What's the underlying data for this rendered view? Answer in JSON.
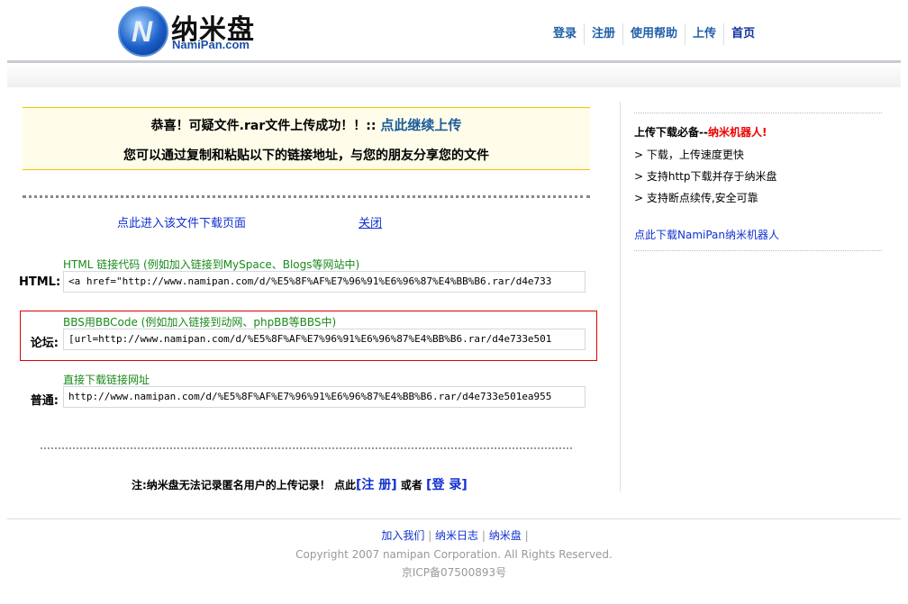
{
  "header": {
    "logo_cn": "纳米盘",
    "logo_en": "NamiPan.com",
    "nav": [
      "登录",
      "注册",
      "使用帮助",
      "上传",
      "首页"
    ]
  },
  "notice": {
    "line1": "恭喜！可疑文件.rar文件上传成功！！::",
    "continue_link": "点此继续上传",
    "line2": "您可以通过复制和粘贴以下的链接地址，与您的朋友分享您的文件"
  },
  "links": {
    "download_page": "点此进入该文件下载页面",
    "close": "关闭"
  },
  "codes": [
    {
      "caption": "HTML 链接代码 (例如加入链接到MySpace、Blogs等网站中)",
      "label": "HTML:",
      "value": "<a href=\"http://www.namipan.com/d/%E5%8F%AF%E7%96%91%E6%96%87%E4%BB%B6.rar/d4e733"
    },
    {
      "caption": "BBS用BBCode (例如加入链接到动网、phpBB等BBS中)",
      "label": "论坛:",
      "value": "[url=http://www.namipan.com/d/%E5%8F%AF%E7%96%91%E6%96%87%E4%BB%B6.rar/d4e733e501"
    },
    {
      "caption": "直接下载链接网址",
      "label": "普通:",
      "value": "http://www.namipan.com/d/%E5%8F%AF%E7%96%91%E6%96%87%E4%BB%B6.rar/d4e733e501ea955"
    }
  ],
  "note": {
    "text": "注:纳米盘无法记录匿名用户的上传记录！ 点此",
    "register": "[注 册]",
    "or": "或者",
    "login": "[登 录]"
  },
  "sidebar": {
    "title": "上传下载必备--",
    "title_red": "纳米机器人!",
    "items": [
      "> 下载，上传速度更快",
      "> 支持http下载并存于纳米盘",
      "> 支持断点续传,安全可靠"
    ],
    "link": "点此下载NamiPan纳米机器人"
  },
  "footer": {
    "links": [
      "加入我们",
      "纳米日志",
      "纳米盘"
    ],
    "copyright": "Copyright 2007 namipan Corporation. All Rights Reserved.",
    "icp": "京ICP备07500893号"
  }
}
